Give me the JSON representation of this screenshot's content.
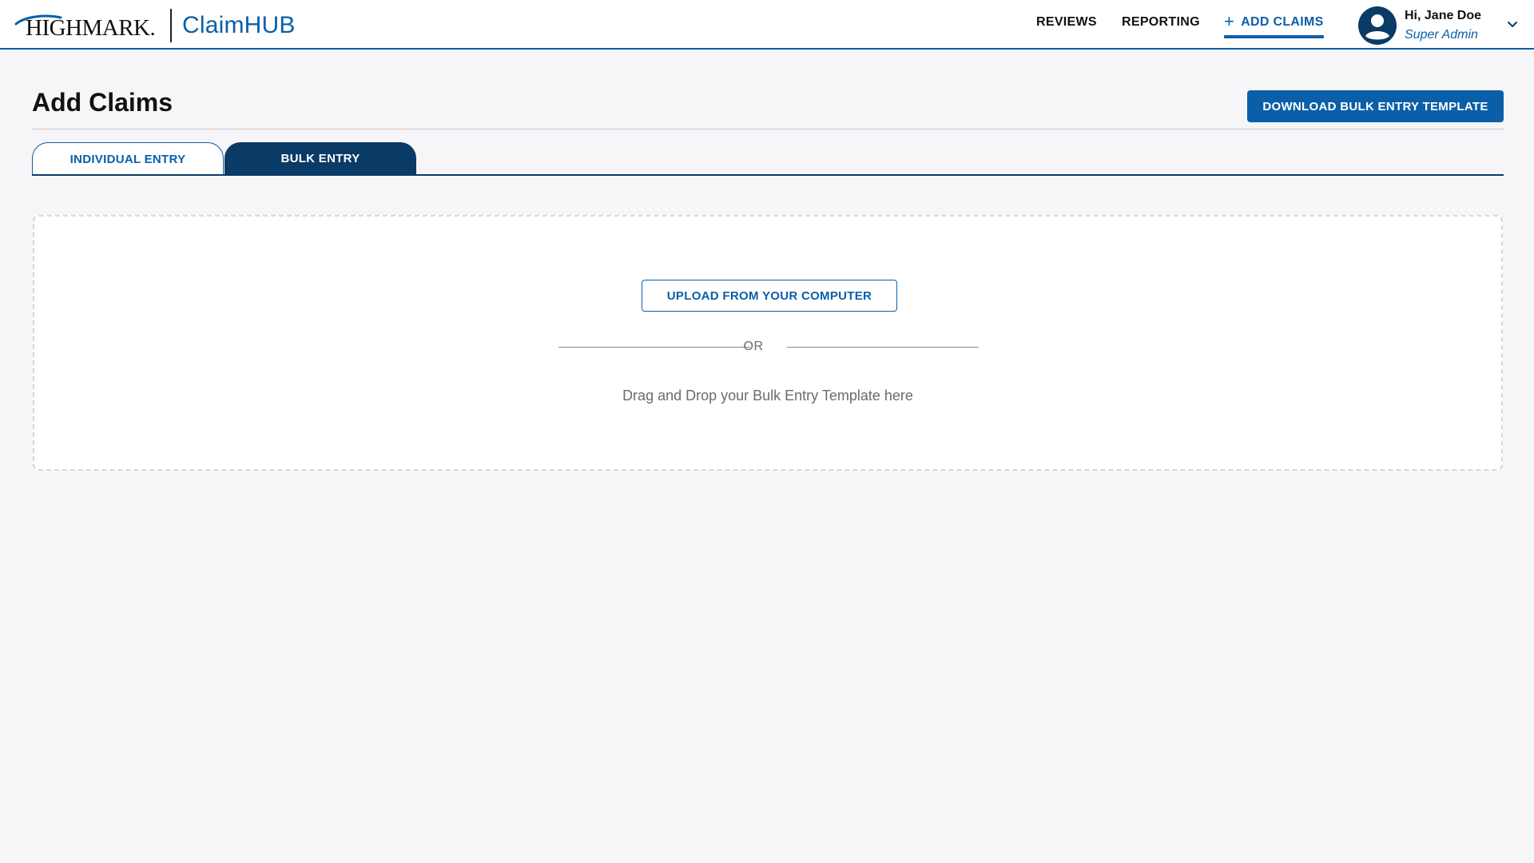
{
  "header": {
    "brand": {
      "logo_text": "HIGHMARK.",
      "product": "ClaimHUB"
    },
    "nav": {
      "reviews": "REVIEWS",
      "reporting": "REPORTING",
      "add_claims": "ADD CLAIMS",
      "add_claims_icon": "+"
    },
    "user": {
      "greeting": "Hi, Jane Doe",
      "role": "Super Admin"
    }
  },
  "page": {
    "title": "Add Claims",
    "download_button": "DOWNLOAD BULK ENTRY TEMPLATE"
  },
  "tabs": {
    "individual": "INDIVIDUAL ENTRY",
    "bulk": "BULK ENTRY",
    "active": "bulk"
  },
  "dropzone": {
    "upload_button": "UPLOAD FROM YOUR COMPUTER",
    "separator": "OR",
    "instruction": "Drag and Drop your Bulk Entry Template here"
  },
  "colors": {
    "primary": "#0b5fa8",
    "dark_navy": "#0a3a66",
    "background": "#f6f5f8",
    "muted_text": "#6b6b70"
  }
}
